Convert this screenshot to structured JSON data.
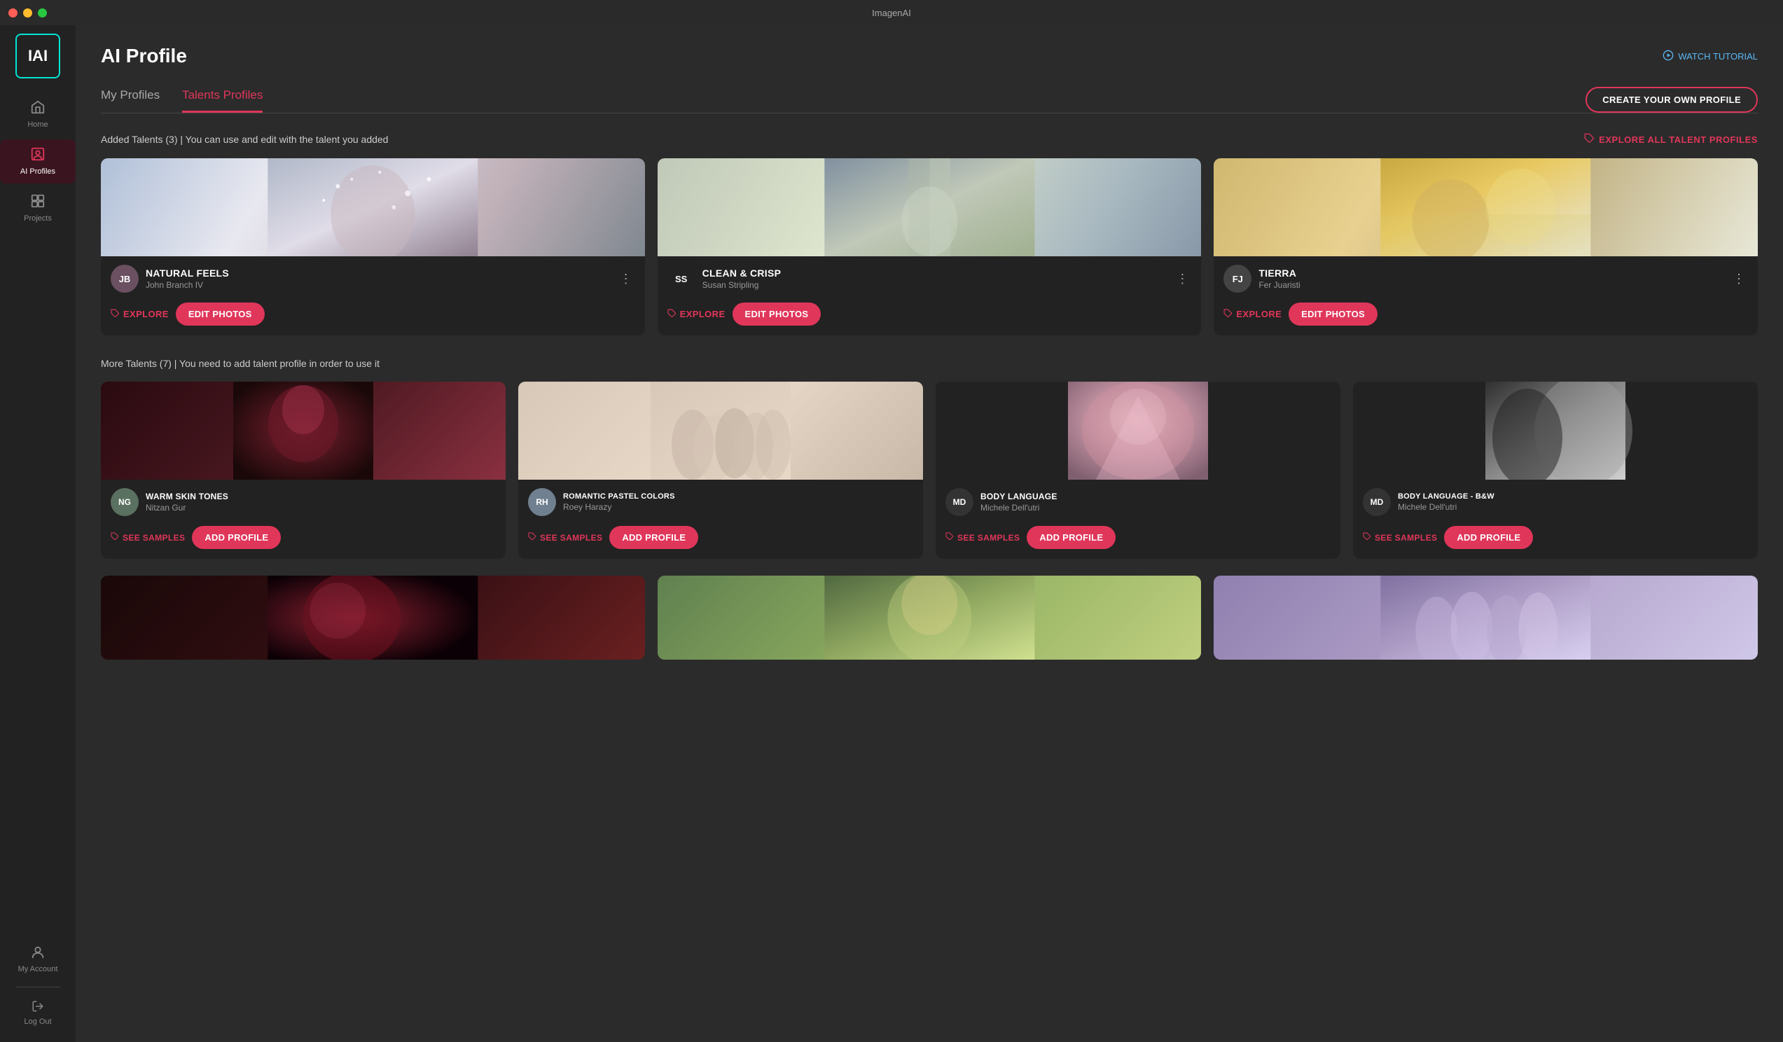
{
  "titlebar": {
    "title": "ImagenAI"
  },
  "sidebar": {
    "logo": "IAI",
    "items": [
      {
        "id": "home",
        "label": "Home",
        "icon": "🏠",
        "active": false
      },
      {
        "id": "ai-profiles",
        "label": "AI Profiles",
        "icon": "👤",
        "active": true
      },
      {
        "id": "projects",
        "label": "Projects",
        "icon": "📁",
        "active": false
      }
    ],
    "bottom": {
      "account_label": "My Account",
      "logout_label": "Log Out"
    }
  },
  "page": {
    "title": "AI Profile",
    "watch_tutorial": "WATCH TUTORIAL",
    "tabs": [
      {
        "id": "my-profiles",
        "label": "My Profiles",
        "active": false
      },
      {
        "id": "talents-profiles",
        "label": "Talents Profiles",
        "active": true
      }
    ],
    "create_profile_btn": "CREATE YOUR OWN PROFILE",
    "explore_all_link": "EXPLORE ALL TALENT PROFILES",
    "added_section_label": "Added Talents (3) | You can use and edit with the talent you added",
    "more_section_label": "More Talents (7) | You need to add talent profile in order to use it",
    "explore_btn": "EXPLORE",
    "edit_btn": "EDIT PHOTOS",
    "see_samples_btn": "SEE SAMPLES",
    "add_btn": "ADD PROFILE"
  },
  "added_cards": [
    {
      "id": "natural-feels",
      "name": "NATURAL FEELS",
      "author": "John Branch IV",
      "avatar_char": "JB"
    },
    {
      "id": "clean-crisp",
      "name": "CLEAN & CRISP",
      "author": "Susan Stripling",
      "avatar_char": "SS"
    },
    {
      "id": "tierra",
      "name": "TIERRA",
      "author": "Fer Juaristi",
      "avatar_char": "FJ"
    }
  ],
  "more_cards": [
    {
      "id": "warm-skin-tones",
      "name": "WARM SKIN TONES",
      "author": "Nitzan Gur",
      "avatar_char": "NG"
    },
    {
      "id": "romantic-pastel",
      "name": "ROMANTIC PASTEL COLORS",
      "author": "Roey Harazy",
      "avatar_char": "RH"
    },
    {
      "id": "body-language",
      "name": "BODY LANGUAGE",
      "author": "Michele Dell'utri",
      "avatar_char": "MD"
    },
    {
      "id": "body-language-bw",
      "name": "BODY LANGUAGE - B&W",
      "author": "Michele Dell'utri",
      "avatar_char": "MD"
    }
  ],
  "bottom_cards": [
    {
      "id": "card-b1",
      "bg": "bottom1"
    },
    {
      "id": "card-b2",
      "bg": "bottom2"
    },
    {
      "id": "card-b3",
      "bg": "bottom3"
    }
  ]
}
